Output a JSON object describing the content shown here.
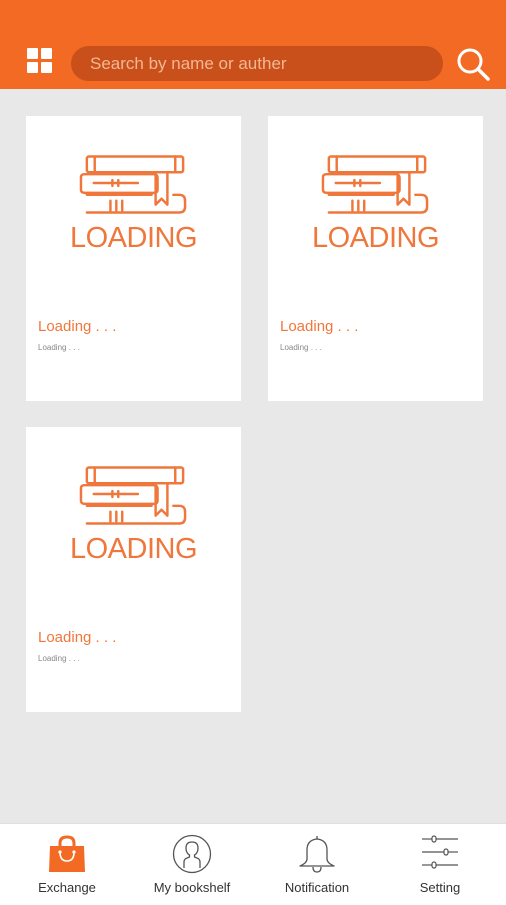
{
  "search": {
    "placeholder": "Search by name or auther"
  },
  "icons": {
    "menu": "grid-icon",
    "search": "search-icon",
    "book_placeholder": "books-stack-icon"
  },
  "colors": {
    "accent": "#f26a24",
    "search_bg": "#c9501b",
    "loading_text": "#f0773c",
    "background": "#e8e8e8"
  },
  "books": [
    {
      "cover_text": "LOADING",
      "title": "Loading . . .",
      "subtitle": "Loading . . ."
    },
    {
      "cover_text": "LOADING",
      "title": "Loading . . .",
      "subtitle": "Loading . . ."
    },
    {
      "cover_text": "LOADING",
      "title": "Loading . . .",
      "subtitle": "Loading . . ."
    }
  ],
  "nav": {
    "items": [
      {
        "label": "Exchange",
        "icon": "shopping-bag-icon",
        "active": true
      },
      {
        "label": "My bookshelf",
        "icon": "user-icon",
        "active": false
      },
      {
        "label": "Notification",
        "icon": "bell-icon",
        "active": false
      },
      {
        "label": "Setting",
        "icon": "sliders-icon",
        "active": false
      }
    ]
  }
}
